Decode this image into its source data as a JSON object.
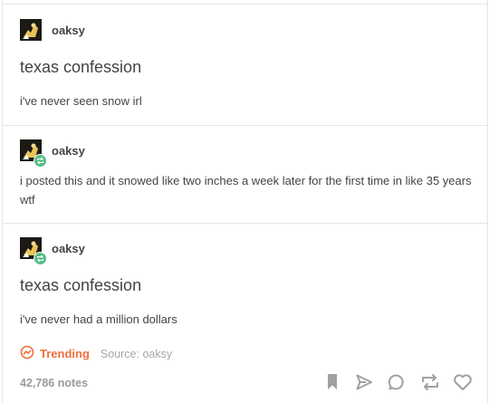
{
  "posts": [
    {
      "username": "oaksy",
      "title": "texas confession",
      "body": "i've never seen snow irl"
    },
    {
      "username": "oaksy",
      "body": "i posted this and it snowed like two inches a week later for the first time in like 35 years wtf"
    },
    {
      "username": "oaksy",
      "title": "texas confession",
      "body": "i've never had a million dollars"
    }
  ],
  "footer": {
    "trending_label": "Trending",
    "source": "Source: oaksy",
    "notes": "42,786 notes"
  },
  "icons": {
    "trending": "trending-icon",
    "bookmark": "bookmark-icon",
    "share": "share-icon",
    "reply": "reply-icon",
    "reblog": "reblog-icon",
    "like": "heart-icon"
  },
  "colors": {
    "text": "#444444",
    "trending": "#f06e3c",
    "muted": "#a8a8a8",
    "reblog_badge": "#56bc8a",
    "divider": "#e4e4e4"
  }
}
